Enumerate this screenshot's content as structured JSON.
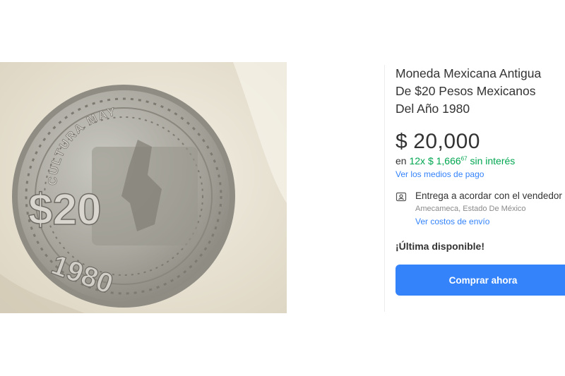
{
  "product": {
    "title_lines": [
      "Moneda Mexicana Antigua",
      "De $20 Pesos Mexicanos",
      "Del Año 1980"
    ],
    "price": {
      "currency": "$",
      "amount": "20,000"
    },
    "installments": {
      "prefix": "en",
      "count": "12x",
      "currency": "$",
      "amount": "1,666",
      "cents": "67",
      "suffix": "sin interés"
    },
    "payment_link": "Ver los medios de pago",
    "shipping": {
      "icon": "address-card-icon",
      "title": "Entrega a acordar con el vendedor",
      "location": "Amecameca, Estado De México",
      "link": "Ver costos de envío"
    },
    "stock_text": "¡Última disponible!",
    "buy_label": "Comprar ahora"
  },
  "image": {
    "coin_denomination": "$20",
    "coin_year": "1980",
    "coin_inscription": "CULTURA MAYA"
  },
  "colors": {
    "link": "#3483fa",
    "green": "#00a650",
    "button_bg": "#3483fa",
    "text": "#333333"
  }
}
